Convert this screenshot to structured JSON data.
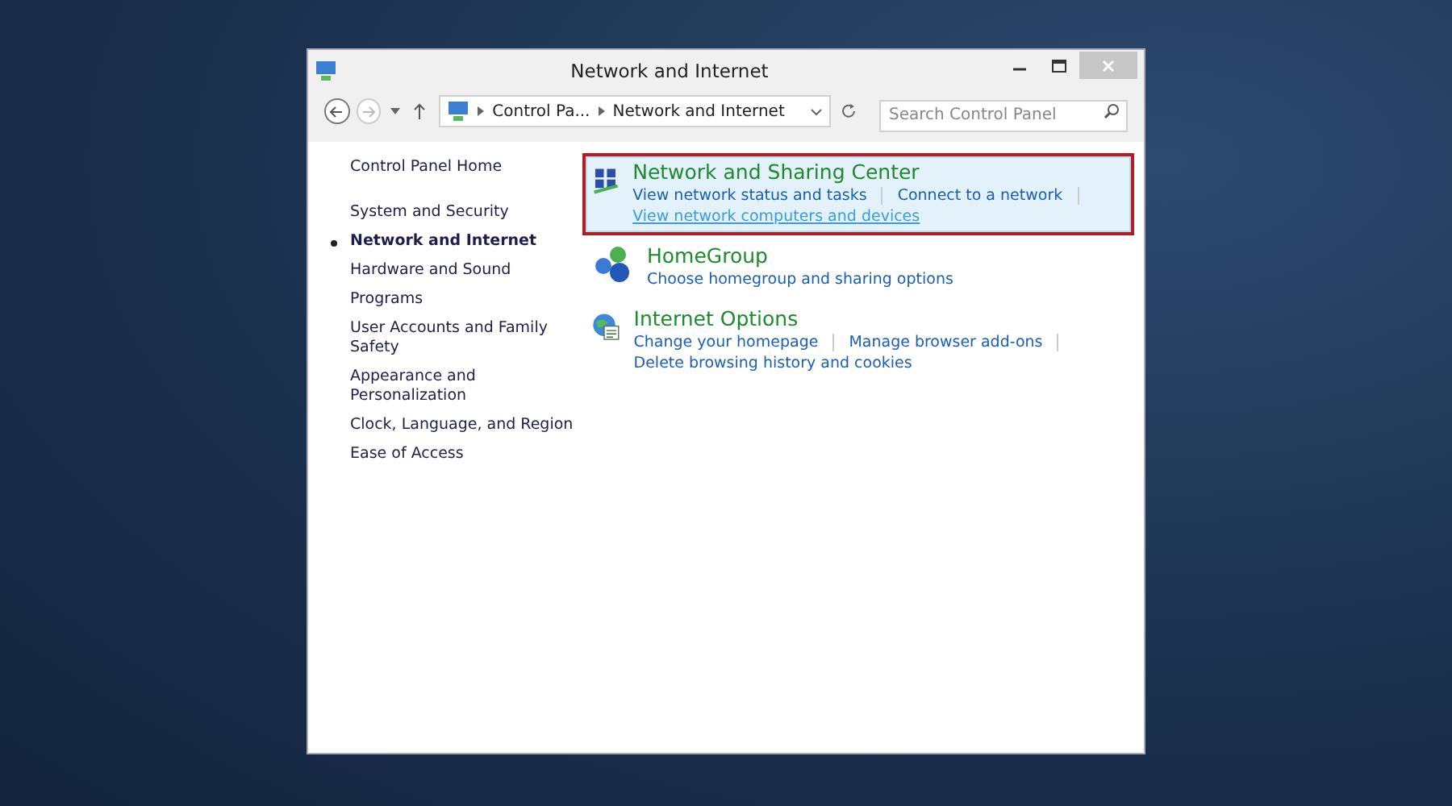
{
  "window": {
    "title": "Network and Internet"
  },
  "address_bar": {
    "breadcrumbs": [
      "Control Pa...",
      "Network and Internet"
    ],
    "search": {
      "placeholder": "Search Control Panel"
    }
  },
  "sidebar": {
    "home": "Control Panel Home",
    "items": [
      {
        "label": "System and Security",
        "selected": false
      },
      {
        "label": "Network and Internet",
        "selected": true
      },
      {
        "label": "Hardware and Sound",
        "selected": false
      },
      {
        "label": "Programs",
        "selected": false
      },
      {
        "label": "User Accounts and Family Safety",
        "selected": false
      },
      {
        "label": "Appearance and Personalization",
        "selected": false
      },
      {
        "label": "Clock, Language, and Region",
        "selected": false
      },
      {
        "label": "Ease of Access",
        "selected": false
      }
    ]
  },
  "categories": [
    {
      "kind": "network",
      "title": "Network and Sharing Center",
      "highlighted": true,
      "links": [
        {
          "label": "View network status and tasks",
          "hovered": false
        },
        {
          "label": "Connect to a network",
          "hovered": false
        },
        {
          "label": "View network computers and devices",
          "hovered": true
        }
      ]
    },
    {
      "kind": "homegroup",
      "title": "HomeGroup",
      "highlighted": false,
      "links": [
        {
          "label": "Choose homegroup and sharing options",
          "hovered": false
        }
      ]
    },
    {
      "kind": "internet",
      "title": "Internet Options",
      "highlighted": false,
      "links": [
        {
          "label": "Change your homepage",
          "hovered": false
        },
        {
          "label": "Manage browser add-ons",
          "hovered": false
        },
        {
          "label": "Delete browsing history and cookies",
          "hovered": false
        }
      ]
    }
  ]
}
